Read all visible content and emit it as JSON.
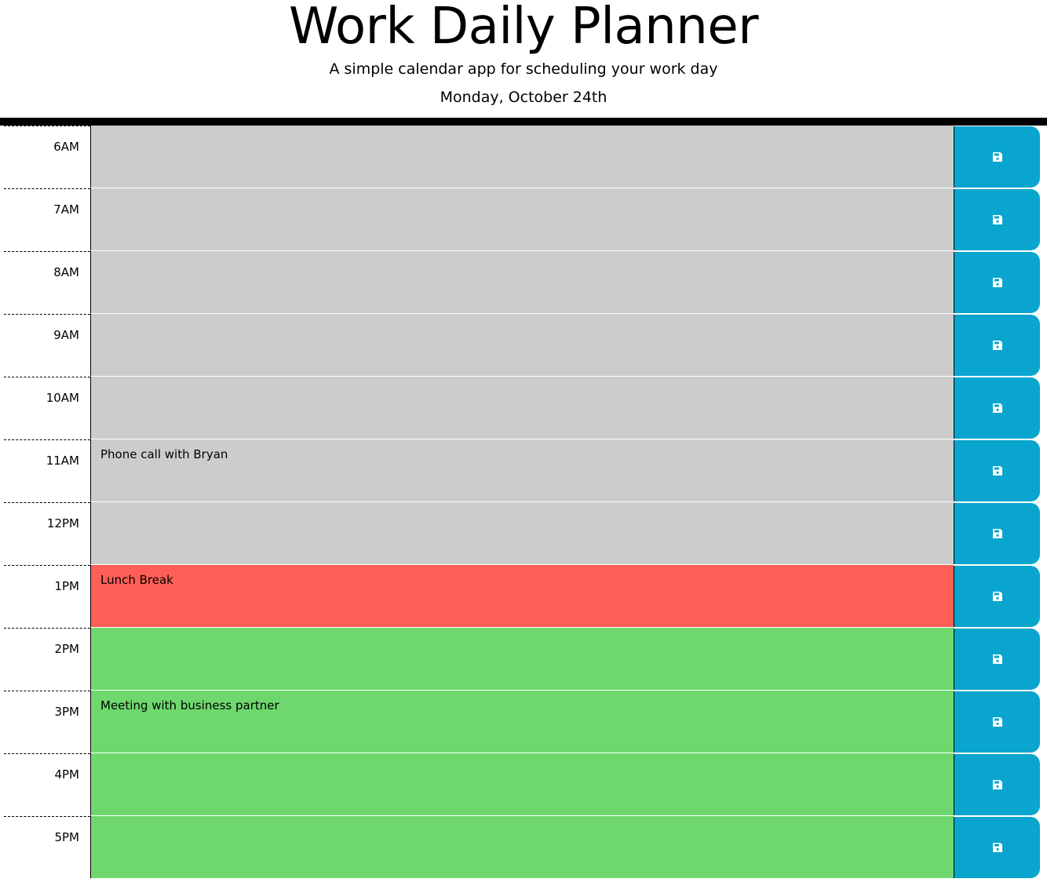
{
  "header": {
    "title": "Work Daily Planner",
    "subtitle": "A simple calendar app for scheduling your work day",
    "current_day": "Monday, October 24th"
  },
  "colors": {
    "past": "#cccccc",
    "present": "#ff5f57",
    "future": "#6ed86e",
    "save_button": "#0aa5cf"
  },
  "time_blocks": [
    {
      "hour": "6AM",
      "text": "",
      "state": "past",
      "icon": "floppy-disk-icon"
    },
    {
      "hour": "7AM",
      "text": "",
      "state": "past",
      "icon": "floppy-disk-icon"
    },
    {
      "hour": "8AM",
      "text": "",
      "state": "past",
      "icon": "floppy-disk-icon"
    },
    {
      "hour": "9AM",
      "text": "",
      "state": "past",
      "icon": "floppy-disk-icon"
    },
    {
      "hour": "10AM",
      "text": "",
      "state": "past",
      "icon": "floppy-disk-icon"
    },
    {
      "hour": "11AM",
      "text": "Phone call with Bryan",
      "state": "past",
      "icon": "floppy-disk-icon"
    },
    {
      "hour": "12PM",
      "text": "",
      "state": "past",
      "icon": "floppy-disk-icon"
    },
    {
      "hour": "1PM",
      "text": "Lunch Break",
      "state": "present",
      "icon": "floppy-disk-icon"
    },
    {
      "hour": "2PM",
      "text": "",
      "state": "future",
      "icon": "floppy-disk-icon"
    },
    {
      "hour": "3PM",
      "text": "Meeting with business partner",
      "state": "future",
      "icon": "floppy-disk-icon"
    },
    {
      "hour": "4PM",
      "text": "",
      "state": "future",
      "icon": "floppy-disk-icon"
    },
    {
      "hour": "5PM",
      "text": "",
      "state": "future",
      "icon": "floppy-disk-icon"
    }
  ]
}
